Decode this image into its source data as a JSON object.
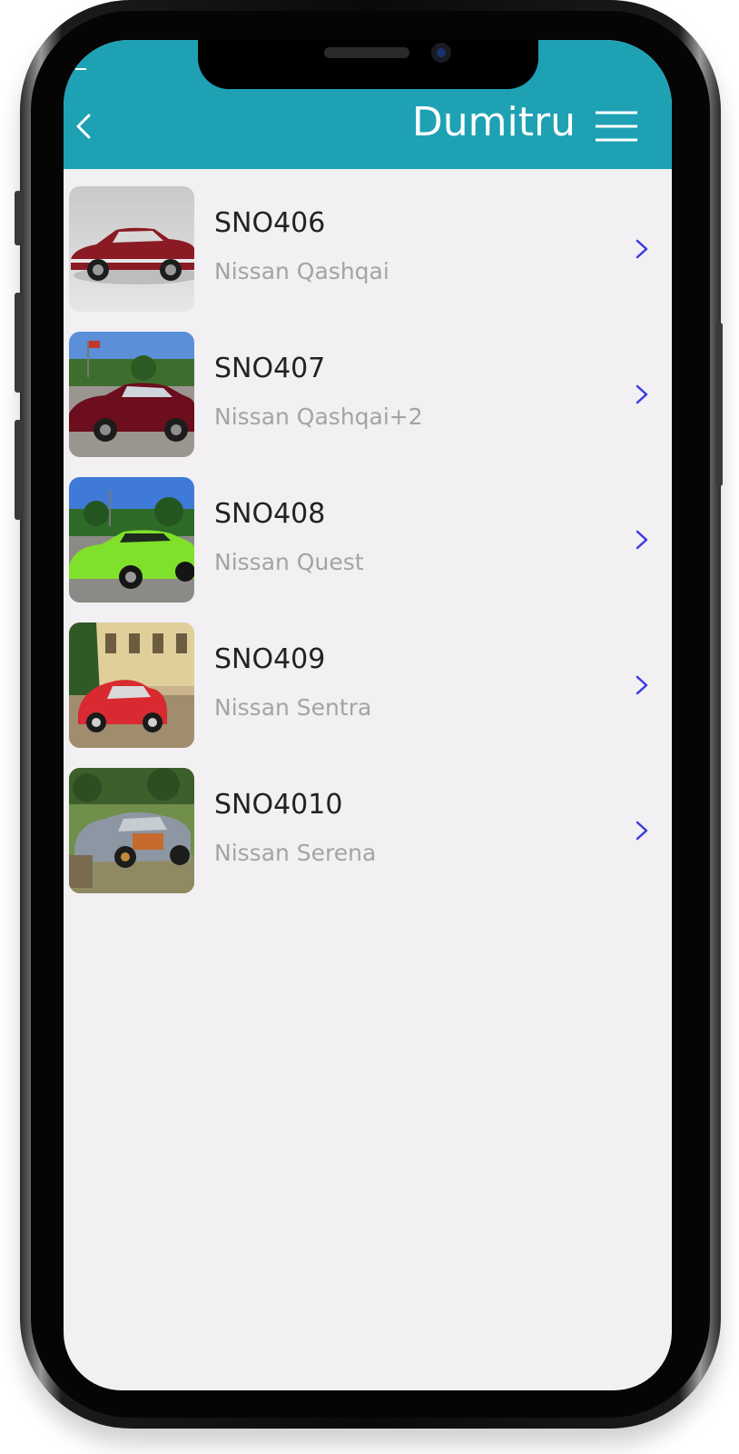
{
  "header": {
    "title": "Dumitru",
    "back_icon": "chevron-left-icon",
    "menu_icon": "hamburger-menu-icon",
    "background_color": "#1fa1b4"
  },
  "vehicles": [
    {
      "code": "SNO406",
      "model": "Nissan Qashqai"
    },
    {
      "code": "SNO407",
      "model": "Nissan Qashqai+2"
    },
    {
      "code": "SNO408",
      "model": "Nissan Quest"
    },
    {
      "code": "SNO409",
      "model": "Nissan Sentra"
    },
    {
      "code": "SNO4010",
      "model": "Nissan Serena"
    }
  ],
  "colors": {
    "accent": "#1fa1b4",
    "chevron": "#3a3ae0",
    "title_text": "#222222",
    "subtitle_text": "#a4a4a4",
    "background": "#f2f0f2"
  }
}
